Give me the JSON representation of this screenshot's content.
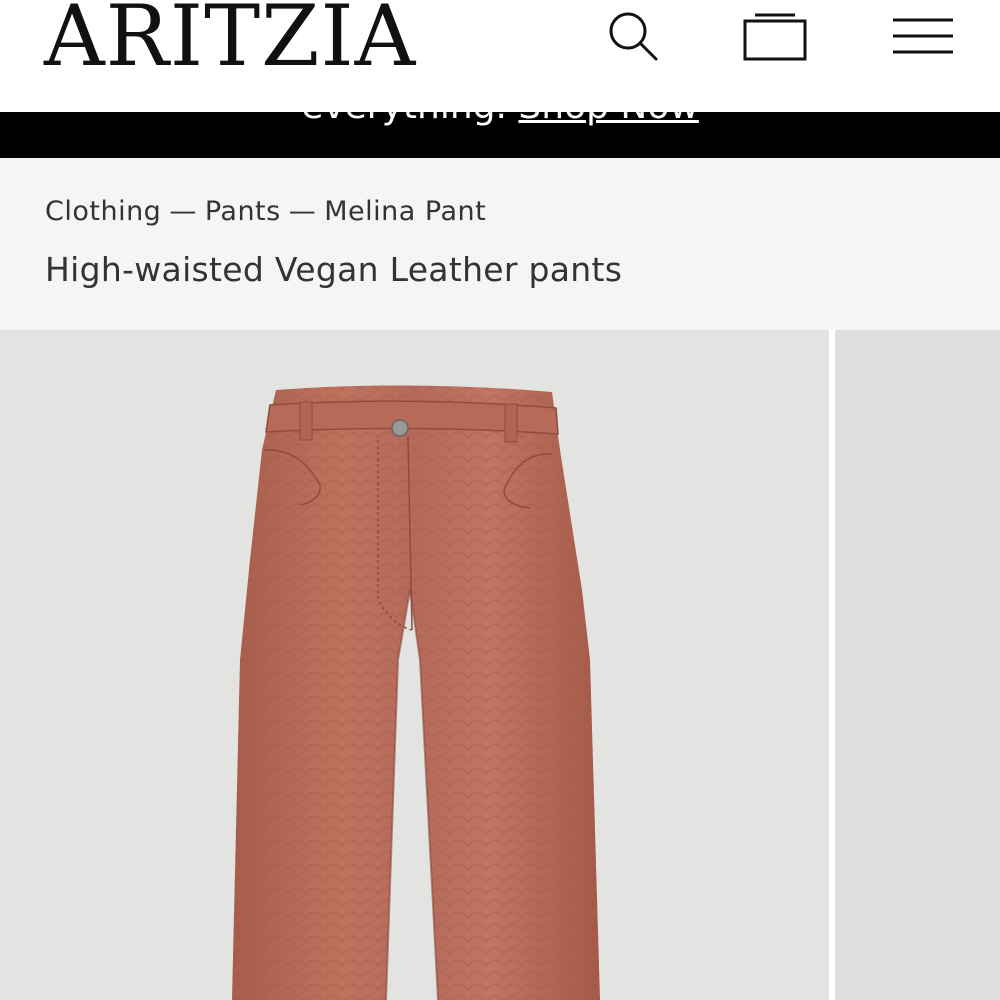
{
  "header": {
    "logo_text": "ARITZIA",
    "icons": {
      "search": "search-icon",
      "bag": "shopping-bag-icon",
      "menu": "hamburger-menu-icon"
    }
  },
  "promo": {
    "text": "everything.",
    "link_label": "Shop Now"
  },
  "breadcrumb": {
    "items": [
      "Clothing",
      "Pants",
      "Melina Pant"
    ],
    "separator": "—"
  },
  "product": {
    "title": "High-waisted Vegan Leather pants"
  },
  "colors": {
    "promo_bg": "#000000",
    "info_bg": "#f5f5f5",
    "gallery_bg": "#e3e3e2",
    "product_color": "#b86a57"
  }
}
